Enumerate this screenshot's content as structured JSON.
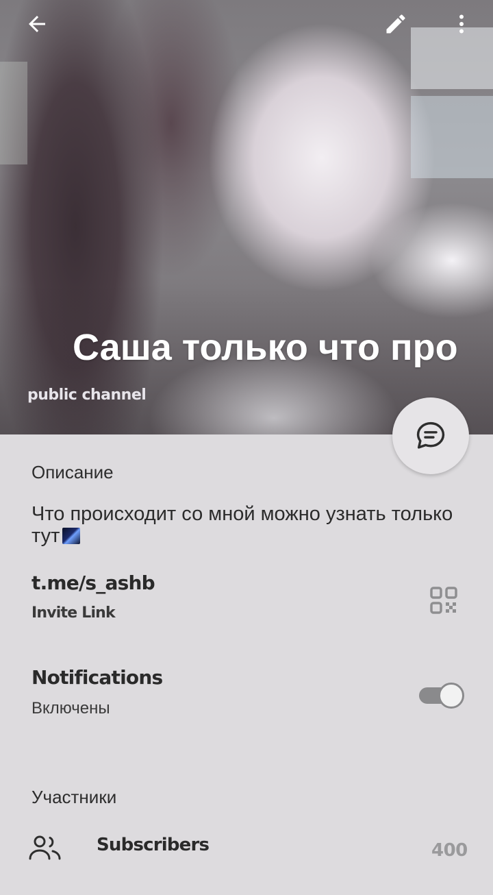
{
  "header": {
    "back_icon": "arrow-left-icon",
    "edit_icon": "pencil-icon",
    "more_icon": "more-vert-icon",
    "title": "Саша только что про",
    "subtitle": "public channel"
  },
  "fab": {
    "icon": "chat-bubble-icon"
  },
  "description": {
    "label": "Описание",
    "text": "Что происходит со мной можно узнать только тут"
  },
  "invite": {
    "link": "t.me/s_ashb",
    "caption": "Invite Link",
    "qr_icon": "qr-code-icon"
  },
  "notifications": {
    "title": "Notifications",
    "status": "Включены",
    "enabled": true
  },
  "members": {
    "label": "Участники",
    "subscribers_label": "Subscribers",
    "subscribers_count": "400",
    "icon": "people-icon"
  },
  "colors": {
    "background": "#dddbde",
    "text": "#2a2a2a",
    "muted": "#9a9a9c",
    "toggle": "#8a8a8c"
  }
}
